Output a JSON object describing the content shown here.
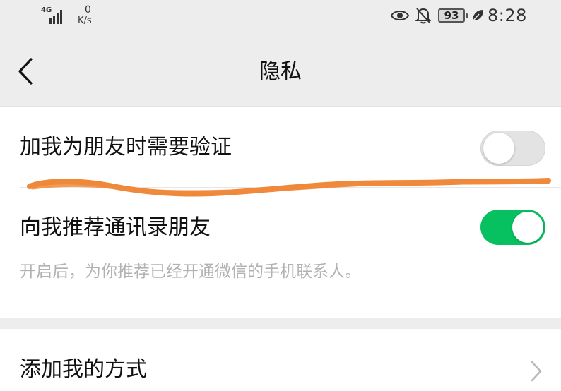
{
  "status_bar": {
    "network": "4G",
    "speed_value": "0",
    "speed_unit": "K/s",
    "battery": "93",
    "time": "8:28"
  },
  "nav": {
    "title": "隐私"
  },
  "settings": {
    "verify_friend": {
      "label": "加我为朋友时需要验证",
      "enabled": false
    },
    "recommend_contacts": {
      "label": "向我推荐通讯录朋友",
      "description": "开启后，为你推荐已经开通微信的手机联系人。",
      "enabled": true
    },
    "add_methods": {
      "label": "添加我的方式"
    }
  },
  "colors": {
    "switch_on": "#07c160",
    "switch_off": "#e3e3e3",
    "annotation": "#f0883a",
    "background": "#ededed"
  }
}
